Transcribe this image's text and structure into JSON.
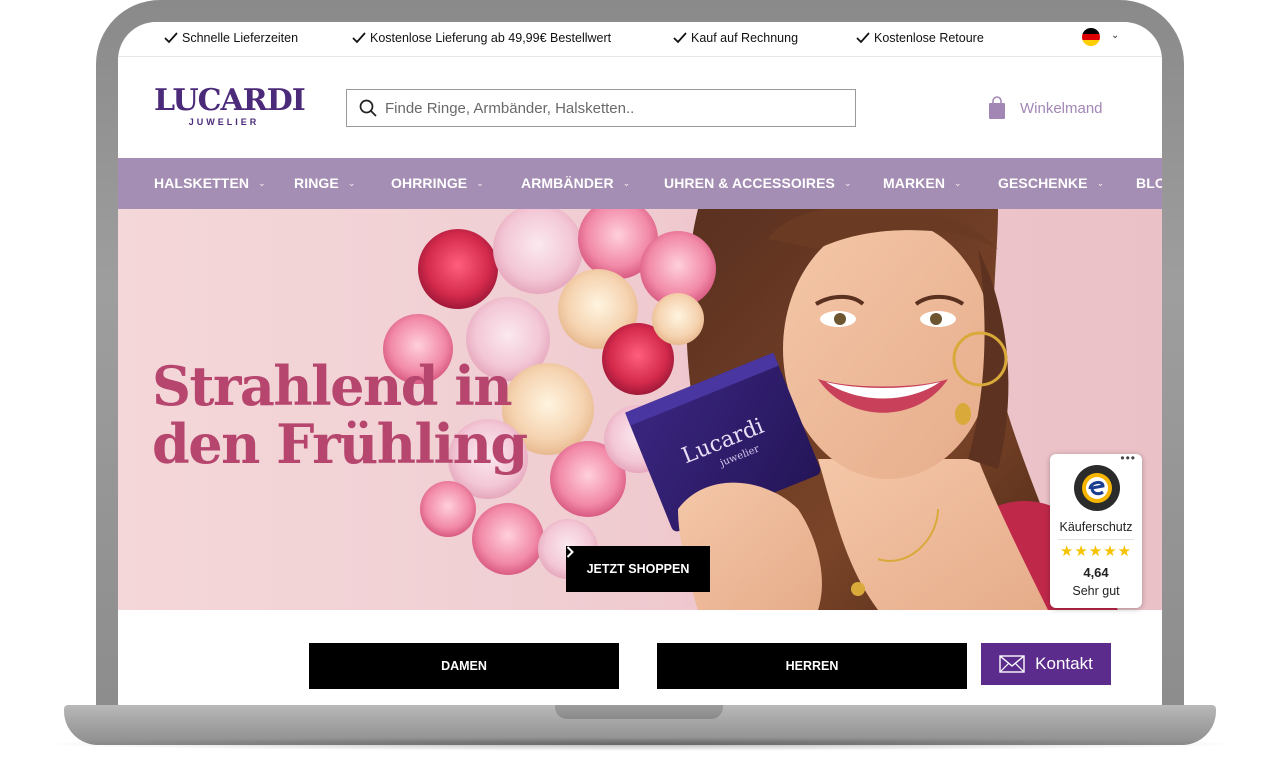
{
  "usp": [
    {
      "label": "Schnelle Lieferzeiten"
    },
    {
      "label": "Kostenlose Lieferung ab 49,99€ Bestellwert"
    },
    {
      "label": "Kauf auf Rechnung"
    },
    {
      "label": "Kostenlose Retoure"
    }
  ],
  "language": {
    "flag": "germany-flag",
    "colors": [
      "#000000",
      "#dd0000",
      "#ffce00"
    ]
  },
  "logo": {
    "main": "LUCARDI",
    "sub": "JUWELIER"
  },
  "search": {
    "placeholder": "Finde Ringe, Armbänder, Halsketten.."
  },
  "cart": {
    "label": "Winkelmand"
  },
  "nav": {
    "items": [
      {
        "label": "HALSKETTEN"
      },
      {
        "label": "RINGE"
      },
      {
        "label": "OHRRINGE"
      },
      {
        "label": "ARMBÄNDER"
      },
      {
        "label": "UHREN & ACCESSOIRES"
      },
      {
        "label": "MARKEN"
      },
      {
        "label": "GESCHENKE"
      },
      {
        "label": "BLO"
      }
    ]
  },
  "hero": {
    "title_line1": "Strahlend in",
    "title_line2": "den Frühling",
    "cta": "JETZT SHOPPEN",
    "box_brand": "Lucardi",
    "box_sub": "juwelier"
  },
  "trusted": {
    "more": "•••",
    "label": "Käuferschutz",
    "stars": "★★★★★",
    "score": "4,64",
    "rating": "Sehr gut"
  },
  "buttons": {
    "damen": "DAMEN",
    "herren": "HERREN",
    "kontakt": "Kontakt"
  },
  "colors": {
    "brand": "#4b2a7a",
    "nav_bg": "#a58eb3",
    "hero_title": "#b6466e",
    "kontakt_bg": "#5b2c8c",
    "cart": "#a287b4"
  }
}
